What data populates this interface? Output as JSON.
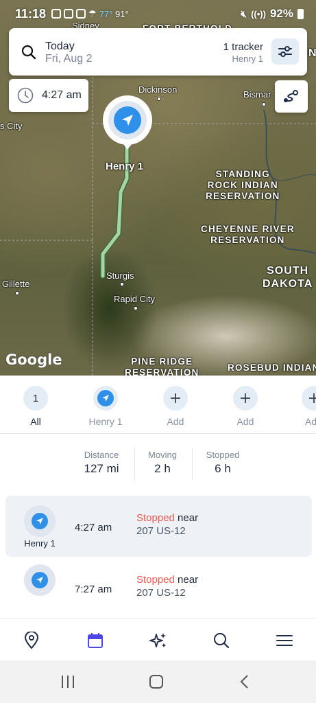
{
  "status_bar": {
    "time": "11:18",
    "temp_current": "77°",
    "temp_high": "91°",
    "battery": "92%"
  },
  "search": {
    "date_title": "Today",
    "date_sub": "Fri, Aug 2",
    "tracker_count": "1 tracker",
    "tracker_name": "Henry 1"
  },
  "time_chip": {
    "time": "4:27 am"
  },
  "map": {
    "marker_label": "Henry 1",
    "google_logo": "Google",
    "labels": {
      "fort_berthold": "FORT BERTHOLD",
      "sidney": "Sidney",
      "dickinson": "Dickinson",
      "bismarck": "Bismar",
      "city_left": "s City",
      "standing_rock": "STANDING\nROCK INDIAN\nRESERVATION",
      "cheyenne_river": "CHEYENNE RIVER\nRESERVATION",
      "south_dakota": "SOUTH\nDAKOTA",
      "gillette": "Gillette",
      "sturgis": "Sturgis",
      "rapid_city": "Rapid City",
      "pine_ridge": "PINE RIDGE\nRESERVATION",
      "rosebud": "ROSEBUD INDIAN",
      "north_edge": "N"
    }
  },
  "trackers": [
    {
      "label": "All",
      "value": "1",
      "active": true
    },
    {
      "label": "Henry 1",
      "active": false
    },
    {
      "label": "Add"
    },
    {
      "label": "Add"
    },
    {
      "label": "Ad"
    }
  ],
  "stats": {
    "distance_label": "Distance",
    "distance_value": "127 mi",
    "moving_label": "Moving",
    "moving_value": "2 h",
    "stopped_label": "Stopped",
    "stopped_value": "6 h"
  },
  "events": [
    {
      "avatar_name": "Henry 1",
      "time": "4:27 am",
      "status": "Stopped",
      "near": " near",
      "address": "207 US-12",
      "selected": true
    },
    {
      "avatar_name": "",
      "time": "7:27 am",
      "status": "Stopped",
      "near": " near",
      "address": "207 US-12",
      "selected": false
    }
  ],
  "nav": {
    "items": [
      "map-pin",
      "calendar",
      "sparkles",
      "search",
      "menu"
    ],
    "active": "calendar"
  },
  "colors": {
    "accent": "#2e90e8",
    "stopped": "#e85a50",
    "nav_active": "#4f46e5",
    "route": "#9bc89a"
  }
}
